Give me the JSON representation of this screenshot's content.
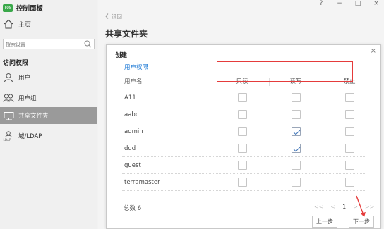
{
  "app": {
    "title": "控制面板",
    "logo_text": "TOS"
  },
  "sidebar": {
    "home_label": "主页",
    "search_placeholder": "搜索设置",
    "section_label": "访问权限",
    "items": [
      {
        "label": "用户",
        "icon": "user-icon"
      },
      {
        "label": "用户组",
        "icon": "user-group-icon"
      },
      {
        "label": "共享文件夹",
        "icon": "shared-folder-icon",
        "active": true
      },
      {
        "label": "域/LDAP",
        "icon": "ldap-icon"
      }
    ]
  },
  "window_controls": {
    "help": "?",
    "minimize": "−",
    "maximize": "□",
    "close": "×"
  },
  "breadcrumb": {
    "back": "设回"
  },
  "page": {
    "title": "共享文件夹"
  },
  "dialog": {
    "title": "创建",
    "close": "×",
    "tab": "用户权限",
    "columns": {
      "name": "用户名",
      "read_only": "只读",
      "read_write": "读写",
      "deny": "禁止"
    },
    "rows": [
      {
        "name": "A11",
        "read_only": false,
        "read_write": false,
        "deny": false
      },
      {
        "name": "aabc",
        "read_only": false,
        "read_write": false,
        "deny": false
      },
      {
        "name": "admin",
        "read_only": false,
        "read_write": true,
        "deny": false
      },
      {
        "name": "ddd",
        "read_only": false,
        "read_write": true,
        "deny": false
      },
      {
        "name": "guest",
        "read_only": false,
        "read_write": false,
        "deny": false
      },
      {
        "name": "terramaster",
        "read_only": false,
        "read_write": false,
        "deny": false
      }
    ],
    "total": "总数 6",
    "pager": {
      "first": "<<",
      "prev": "<",
      "page": "1",
      "next": ">",
      "last": ">>"
    },
    "prev_button": "上一步",
    "next_button": "下一步"
  },
  "colors": {
    "accent": "#1f7bd6",
    "brand": "#3aa84a",
    "highlight_box": "#e53b3b",
    "active_nav": "#9a9a9a"
  }
}
